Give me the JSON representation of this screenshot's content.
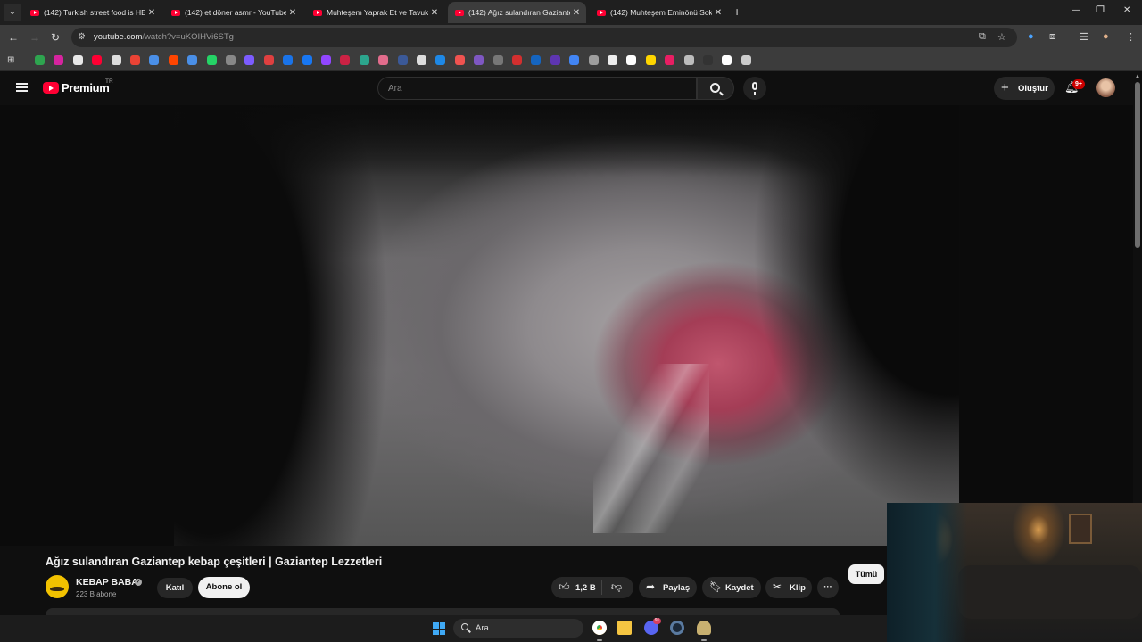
{
  "browser": {
    "tabs": [
      {
        "title": "(142) Turkish street food is HEA",
        "active": false
      },
      {
        "title": "(142) et döner asmr - YouTube",
        "active": false
      },
      {
        "title": "Muhteşem Yaprak Et ve Tavuk D",
        "active": false
      },
      {
        "title": "(142) Ağız sulandıran Gaziantep",
        "active": true
      },
      {
        "title": "(142) Muhteşem Eminönü Soka",
        "active": false
      }
    ],
    "new_tab": "+",
    "url_domain": "youtube.com",
    "url_path": "/watch?v=uKOIHVi6STg"
  },
  "bookmarks": [
    {
      "color": "#2ea44f"
    },
    {
      "color": "#d6249f"
    },
    {
      "color": "#e8e8e8"
    },
    {
      "color": "#ff0033"
    },
    {
      "color": "#dddddd"
    },
    {
      "color": "#ea4335"
    },
    {
      "color": "#4a8fe7"
    },
    {
      "color": "#ff4500"
    },
    {
      "color": "#4a8fe7"
    },
    {
      "color": "#25d366"
    },
    {
      "color": "#888888"
    },
    {
      "color": "#7c5cff"
    },
    {
      "color": "#e04040"
    },
    {
      "color": "#1a73e8"
    },
    {
      "color": "#1877f2"
    },
    {
      "color": "#9146ff"
    },
    {
      "color": "#cc2244"
    },
    {
      "color": "#2ca58d"
    },
    {
      "color": "#e26c8c"
    },
    {
      "color": "#3b5998"
    },
    {
      "color": "#dddddd"
    },
    {
      "color": "#1e88e5"
    },
    {
      "color": "#ef5350"
    },
    {
      "color": "#7e57c2"
    },
    {
      "color": "#777777"
    },
    {
      "color": "#d32f2f"
    },
    {
      "color": "#1565c0"
    },
    {
      "color": "#5e35b1"
    },
    {
      "color": "#4285f4"
    },
    {
      "color": "#9e9e9e"
    },
    {
      "color": "#eeeeee"
    },
    {
      "color": "#ffffff"
    },
    {
      "color": "#ffd600"
    },
    {
      "color": "#e91e63"
    },
    {
      "color": "#bdbdbd"
    },
    {
      "color": "#333333"
    },
    {
      "color": "#ffffff"
    },
    {
      "color": "#cccccc"
    }
  ],
  "youtube": {
    "logo_text": "Premium",
    "logo_region": "TR",
    "search_placeholder": "Ara",
    "create_label": "Oluştur",
    "notification_badge": "9+"
  },
  "video": {
    "title": "Ağız sulandıran Gaziantep kebap çeşitleri | Gaziantep Lezzetleri",
    "channel_name": "KEBAP BABA",
    "verified": "✓",
    "subscribers": "223 B abone",
    "join_label": "Katıl",
    "subscribe_label": "Abone ol",
    "likes": "1,2 B",
    "share_label": "Paylaş",
    "save_label": "Kaydet",
    "clip_label": "Klip",
    "more_label": "···"
  },
  "chips": {
    "all_label": "Tümü"
  },
  "taskbar": {
    "search_placeholder": "Ara",
    "discord_badge": "91"
  }
}
